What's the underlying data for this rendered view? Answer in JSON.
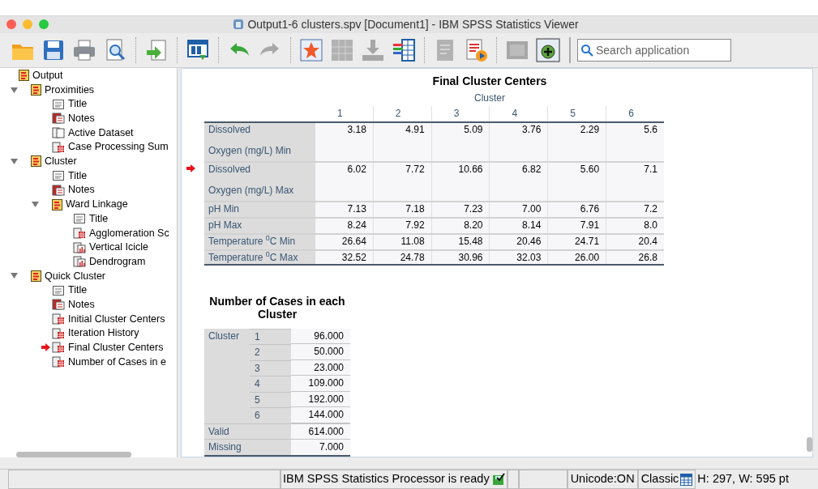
{
  "window": {
    "title": "Output1-6 clusters.spv [Document1] - IBM SPSS Statistics Viewer"
  },
  "toolbar": {
    "buttons": [
      {
        "kind": "open",
        "disabled": false
      },
      {
        "kind": "save",
        "disabled": false
      },
      {
        "kind": "print",
        "disabled": false
      },
      {
        "kind": "preview",
        "disabled": false
      },
      {
        "kind": "export",
        "disabled": false
      },
      {
        "kind": "goto",
        "disabled": false
      },
      {
        "kind": "undo",
        "disabled": false
      },
      {
        "kind": "redo",
        "disabled": true
      },
      {
        "kind": "star",
        "disabled": false
      },
      {
        "kind": "grid",
        "disabled": true
      },
      {
        "kind": "insert",
        "disabled": true
      },
      {
        "kind": "variables",
        "disabled": false
      },
      {
        "kind": "doc",
        "disabled": true
      },
      {
        "kind": "play",
        "disabled": false
      },
      {
        "kind": "blank",
        "disabled": true
      },
      {
        "kind": "plus",
        "disabled": false
      }
    ],
    "search": {
      "placeholder": "Search application"
    }
  },
  "tree": [
    {
      "label": "Output",
      "kind": "book",
      "current": false,
      "children": [
        {
          "label": "Proximities",
          "kind": "book",
          "expanded": true,
          "current": false,
          "children": [
            {
              "label": "Title",
              "kind": "title",
              "current": false
            },
            {
              "label": "Notes",
              "kind": "notes",
              "current": false
            },
            {
              "label": "Active Dataset",
              "kind": "dataset",
              "current": false
            },
            {
              "label": "Case Processing Sum",
              "kind": "table",
              "current": false
            }
          ]
        },
        {
          "label": "Cluster",
          "kind": "book",
          "expanded": true,
          "current": false,
          "children": [
            {
              "label": "Title",
              "kind": "title",
              "current": false
            },
            {
              "label": "Notes",
              "kind": "notes",
              "current": false
            },
            {
              "label": "Ward Linkage",
              "kind": "book",
              "expanded": true,
              "current": false,
              "children": [
                {
                  "label": "Title",
                  "kind": "title",
                  "current": false
                },
                {
                  "label": "Agglomeration Sc",
                  "kind": "table",
                  "current": false
                },
                {
                  "label": "Vertical Icicle",
                  "kind": "chart",
                  "current": false
                },
                {
                  "label": "Dendrogram",
                  "kind": "chart",
                  "current": false
                }
              ]
            }
          ]
        },
        {
          "label": "Quick Cluster",
          "kind": "book",
          "expanded": true,
          "current": false,
          "children": [
            {
              "label": "Title",
              "kind": "title",
              "current": false
            },
            {
              "label": "Notes",
              "kind": "notes",
              "current": false
            },
            {
              "label": "Initial Cluster Centers",
              "kind": "table",
              "current": false
            },
            {
              "label": "Iteration History",
              "kind": "table",
              "current": false
            },
            {
              "label": "Final Cluster Centers",
              "kind": "table",
              "current": true
            },
            {
              "label": "Number of Cases in e",
              "kind": "table",
              "current": false
            }
          ]
        }
      ]
    }
  ],
  "centers_table": {
    "title": "Final Cluster Centers",
    "header": "Cluster",
    "columns": [
      "1",
      "2",
      "3",
      "4",
      "5",
      "6"
    ],
    "rows": [
      {
        "label_lines": [
          "Dissolved",
          "Oxygen (mg/L) Min"
        ],
        "current": false,
        "values": [
          "3.18",
          "4.91",
          "5.09",
          "3.76",
          "2.29",
          "5.6"
        ]
      },
      {
        "label_lines": [
          "Dissolved",
          "Oxygen (mg/L) Max"
        ],
        "current": true,
        "values": [
          "6.02",
          "7.72",
          "10.66",
          "6.82",
          "5.60",
          "7.1"
        ]
      },
      {
        "label_lines": [
          "pH Min"
        ],
        "current": false,
        "values": [
          "7.13",
          "7.18",
          "7.23",
          "7.00",
          "6.76",
          "7.2"
        ]
      },
      {
        "label_lines": [
          "pH Max"
        ],
        "current": false,
        "values": [
          "8.24",
          "7.92",
          "8.20",
          "8.14",
          "7.91",
          "8.0"
        ]
      },
      {
        "label_lines": [
          "Temperature $^{0}$C Min"
        ],
        "current": false,
        "values": [
          "26.64",
          "11.08",
          "15.48",
          "20.46",
          "24.71",
          "20.4"
        ]
      },
      {
        "label_lines": [
          "Temperature $^{0}$C Max"
        ],
        "current": false,
        "values": [
          "32.52",
          "24.78",
          "30.96",
          "32.03",
          "26.00",
          "26.8"
        ]
      }
    ]
  },
  "cases_table": {
    "title": "Number of Cases in each Cluster",
    "group_label": "Cluster",
    "cluster_rows": [
      {
        "cluster": "1",
        "value": "96.000"
      },
      {
        "cluster": "2",
        "value": "50.000"
      },
      {
        "cluster": "3",
        "value": "23.000"
      },
      {
        "cluster": "4",
        "value": "109.000"
      },
      {
        "cluster": "5",
        "value": "192.000"
      },
      {
        "cluster": "6",
        "value": "144.000"
      }
    ],
    "total_rows": [
      {
        "label": "Valid",
        "value": "614.000"
      },
      {
        "label": "Missing",
        "value": "7.000"
      }
    ]
  },
  "status_bar": {
    "message": "IBM SPSS Statistics Processor is ready",
    "unicode": "Unicode:ON",
    "mode": "Classic",
    "size": "H: 297, W: 595 pt"
  }
}
